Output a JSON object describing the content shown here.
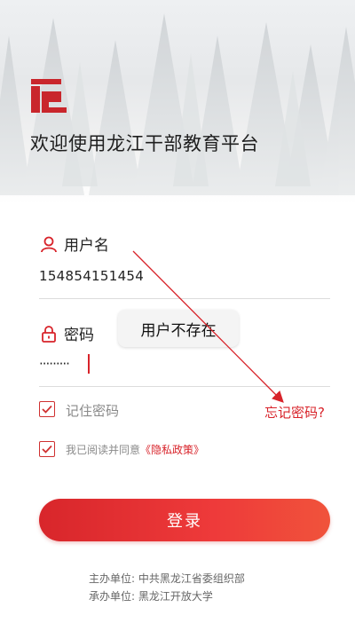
{
  "header": {
    "welcome_text": "欢迎使用龙江干部教育平台"
  },
  "form": {
    "username_label": "用户名",
    "username_value": "154854151454",
    "password_label": "密码",
    "password_masked": "·········",
    "error_tooltip": "用户不存在",
    "remember_label": "记住密码",
    "forgot_link": "忘记密码?",
    "privacy_prefix": "我已阅读并同意",
    "privacy_link": "《隐私政策》",
    "login_button": "登录"
  },
  "footer": {
    "organizer": "主办单位: 中共黑龙江省委组织部",
    "co_organizer": "承办单位: 黑龙江开放大学"
  },
  "colors": {
    "accent": "#d8232a"
  },
  "icons": [
    "logo-icon",
    "user-icon",
    "lock-icon",
    "check-icon"
  ]
}
